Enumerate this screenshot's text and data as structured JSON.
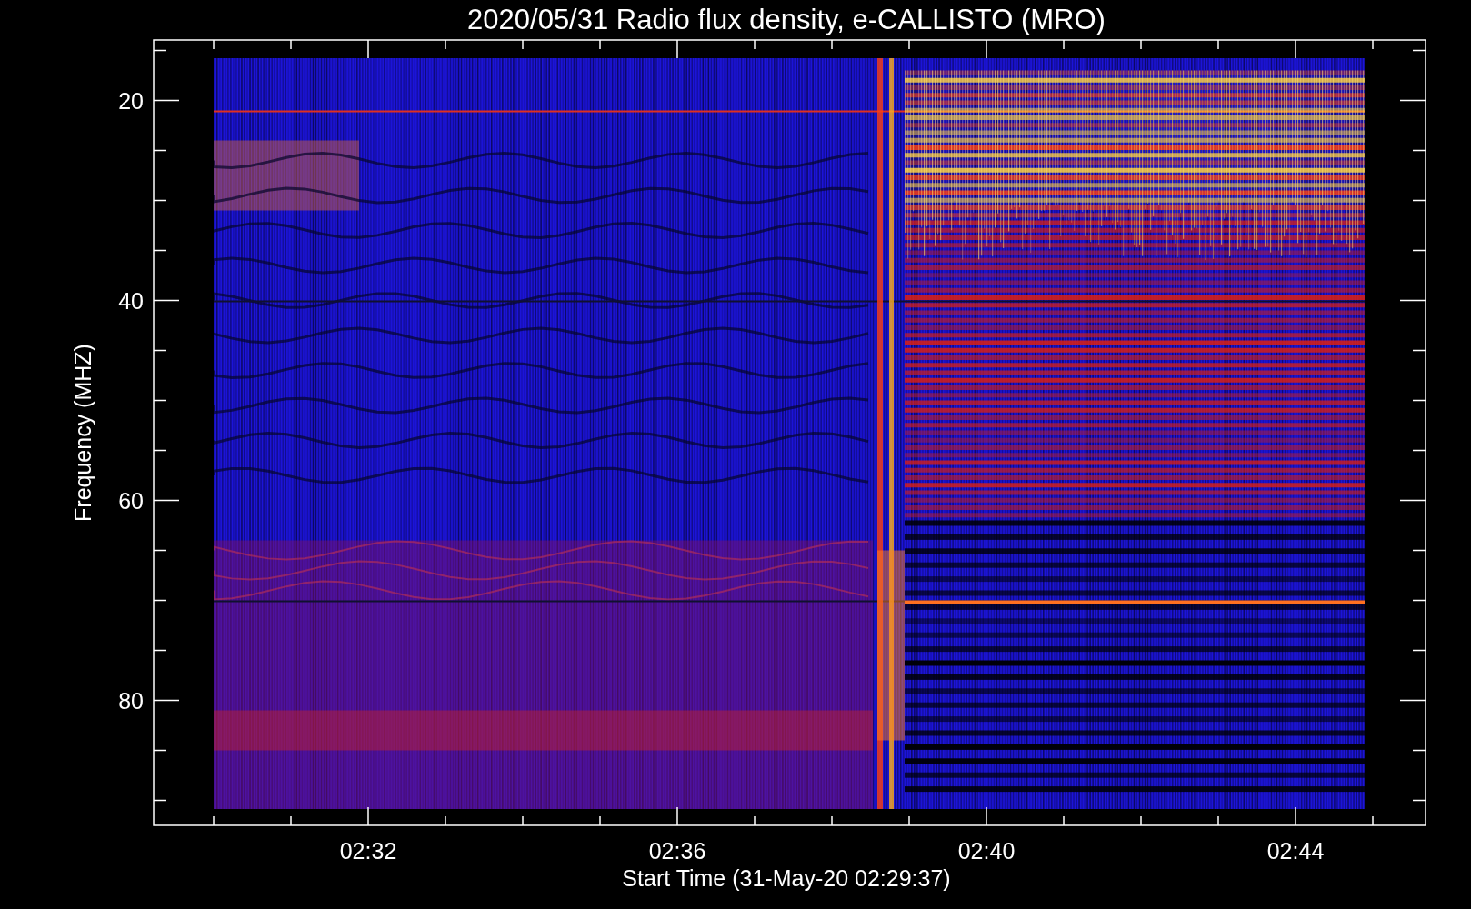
{
  "title": "2020/05/31  Radio flux density, e-CALLISTO (MRO)",
  "y_axis": {
    "label": "Frequency (MHZ)",
    "ticks": [
      "20",
      "40",
      "60",
      "80"
    ]
  },
  "x_axis": {
    "label": "Start Time (31-May-20 02:29:37)",
    "ticks": [
      "02:32",
      "02:36",
      "02:40",
      "02:44"
    ]
  }
}
